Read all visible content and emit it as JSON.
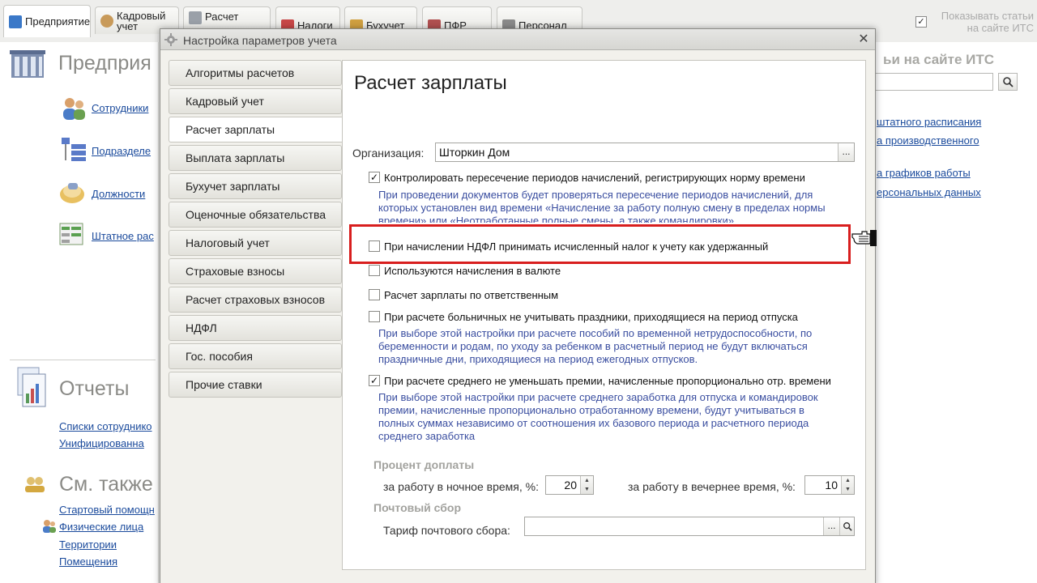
{
  "app_tabs": [
    {
      "label": "Предприятие"
    },
    {
      "label": "Кадровый учет"
    },
    {
      "label": "Расчет"
    },
    {
      "label": "Налоги"
    },
    {
      "label": "Бухучет"
    },
    {
      "label": "ПФР"
    },
    {
      "label": "Персонал"
    }
  ],
  "its_toggle": {
    "label": "Показывать статьи на сайте ИТС",
    "checked": true
  },
  "left_panel": {
    "section1_title": "Предприя",
    "links1": [
      "Сотрудники",
      "Подразделе",
      "Должности",
      "Штатное рас"
    ],
    "section2_title": "Отчеты",
    "links2": [
      "Списки сотруднико",
      "Унифицированна"
    ],
    "section3_title": "См. также",
    "links3": [
      "Стартовый помощн",
      "Физические лица",
      "Территории",
      "Помещения"
    ]
  },
  "right_panel": {
    "title": "ьи на сайте ИТС",
    "links": [
      "штатного расписания",
      "а производственного",
      "а графиков работы",
      "ерсональных данных"
    ]
  },
  "dialog": {
    "title": "Настройка параметров учета",
    "nav": [
      "Алгоритмы расчетов",
      "Кадровый учет",
      "Расчет зарплаты",
      "Выплата зарплаты",
      "Бухучет зарплаты",
      "Оценочные обязательства",
      "Налоговый учет",
      "Страховые взносы",
      "Расчет страховых взносов",
      "НДФЛ",
      "Гос. пособия",
      "Прочие ставки"
    ],
    "active_nav_index": 2,
    "content": {
      "title": "Расчет зарплаты",
      "org_label": "Организация:",
      "org_value": "Шторкин Дом",
      "options": [
        {
          "label": "Контролировать пересечение периодов начислений, регистрирующих норму времени",
          "checked": true,
          "hint": [
            "При проведении документов будет проверяться пересечение периодов начислений, для",
            "которых установлен вид времени «Начисление за работу полную смену в пределах нормы",
            "времени» или «Неотработанные полные смены, а также командировки»"
          ]
        },
        {
          "label": "При начислении НДФЛ принимать исчисленный налог к учету как удержанный",
          "checked": false
        },
        {
          "label": "Используются начисления в валюте",
          "checked": false
        },
        {
          "label": "Расчет зарплаты по ответственным",
          "checked": false
        },
        {
          "label": "При расчете больничных не учитывать праздники, приходящиеся на период отпуска",
          "checked": false,
          "hint": [
            "При выборе этой настройки при расчете пособий по временной нетрудоспособности, по",
            "беременности и родам, по уходу за ребенком в расчетный период не будут включаться",
            "праздничные дни, приходящиеся на период ежегодных отпусков."
          ]
        },
        {
          "label": "При расчете среднего не уменьшать премии, начисленные пропорционально отр. времени",
          "checked": true,
          "hint": [
            "При выборе этой настройки при расчете среднего заработка для отпуска и командировок",
            "премии, начисленные пропорционально отработанному времени, будут учитываться в",
            "полных суммах независимо от соотношения их базового периода и расчетного периода",
            "среднего заработка"
          ]
        }
      ],
      "surcharge_group": "Процент доплаты",
      "night_label": "за работу в ночное время, %:",
      "night_value": "20",
      "evening_label": "за работу в вечернее время, %:",
      "evening_value": "10",
      "postal_group": "Почтовый сбор",
      "tariff_label": "Тариф почтового сбора:",
      "tariff_value": ""
    }
  },
  "colors": {
    "highlight": "#d81e1e",
    "link": "#1a4a9c",
    "hint": "#3a4ea0"
  }
}
